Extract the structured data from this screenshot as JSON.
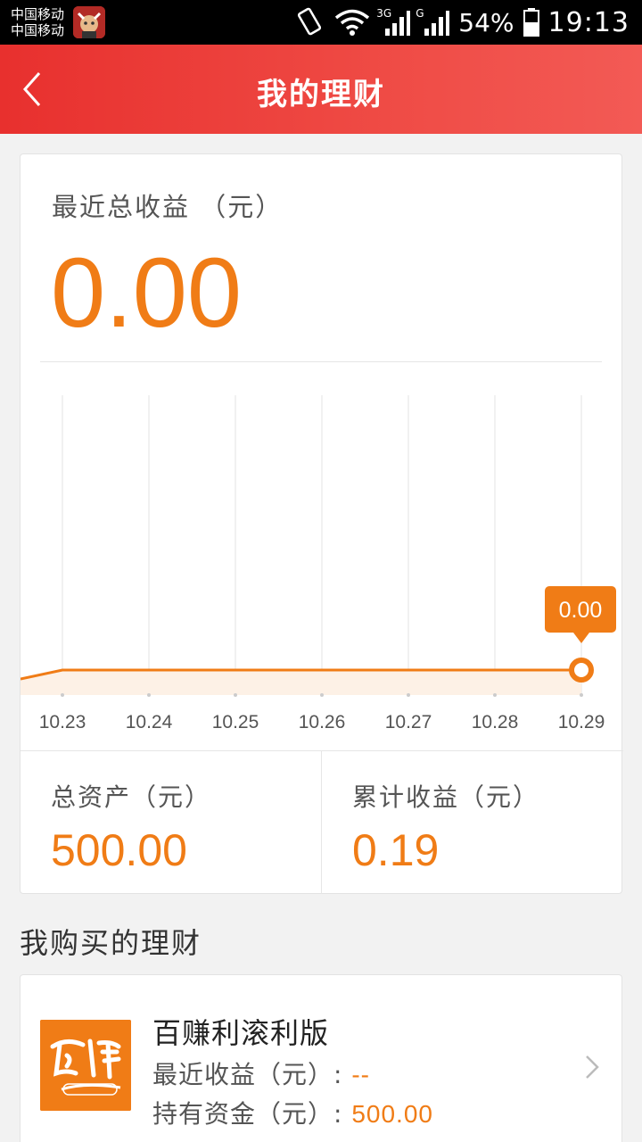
{
  "status_bar": {
    "carrier1": "中国移动",
    "carrier2": "中国移动",
    "net1": "3G",
    "net2": "G",
    "battery": "54%",
    "time": "19:13"
  },
  "header": {
    "title": "我的理财",
    "back_icon": "chevron-left-icon"
  },
  "summary": {
    "recent_label": "最近总收益 （元）",
    "recent_value": "0.00"
  },
  "chart_data": {
    "type": "area",
    "x": [
      "10.23",
      "10.24",
      "10.25",
      "10.26",
      "10.27",
      "10.28",
      "10.29"
    ],
    "series": [
      {
        "values": [
          0,
          0,
          0,
          0,
          0,
          0,
          0
        ]
      }
    ],
    "highlight": {
      "index": 6,
      "label": "0.00"
    },
    "ylim": [
      0,
      1
    ],
    "grid": "vertical",
    "colors": {
      "line": "#f07c16",
      "fill": "#fdf1e6"
    }
  },
  "totals": {
    "assets_label": "总资产（元）",
    "assets_value": "500.00",
    "cumulative_label": "累计收益（元）",
    "cumulative_value": "0.19"
  },
  "purchased": {
    "section_title": "我购买的理财",
    "items": [
      {
        "name": "百赚利滚利版",
        "recent_label": "最近收益（元）: ",
        "recent_value": "--",
        "holding_label": "持有资金（元）: ",
        "holding_value": "500.00"
      }
    ]
  },
  "colors": {
    "accent": "#f07c16",
    "header": "#e8302e"
  }
}
